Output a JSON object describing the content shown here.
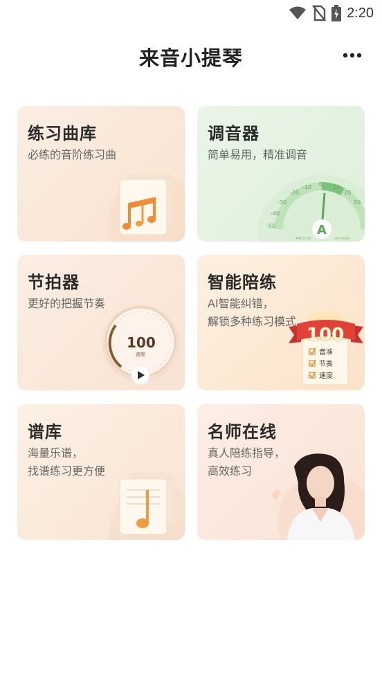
{
  "status_bar": {
    "time": "2:20",
    "icons": [
      "wifi-icon",
      "no-sim-icon",
      "battery-charging-icon"
    ]
  },
  "header": {
    "title": "来音小提琴",
    "more_icon": "more-icon"
  },
  "cards": [
    {
      "title": "练习曲库",
      "subtitle_lines": [
        "必练的音阶练习曲"
      ],
      "icon": "music-sheet-icon"
    },
    {
      "title": "调音器",
      "subtitle_lines": [
        "简单易用，精准调音"
      ],
      "icon": "tuner-gauge-icon",
      "gauge": {
        "scale": [
          "-50",
          "-40",
          "-30",
          "-20",
          "-10",
          "0",
          "10",
          "20",
          "30"
        ],
        "note": "A",
        "left_reading": "440.0 Hz",
        "right_reading": "+0 cents"
      }
    },
    {
      "title": "节拍器",
      "subtitle_lines": [
        "更好的把握节奏"
      ],
      "icon": "metronome-dial-icon",
      "dial": {
        "value": "100",
        "label": "速度"
      }
    },
    {
      "title": "智能陪练",
      "subtitle_lines": [
        "AI智能纠错，",
        "解锁多种练习模式"
      ],
      "icon": "score-badge-icon",
      "badge": {
        "score": "100",
        "checks": [
          "音准",
          "节奏",
          "速度"
        ]
      }
    },
    {
      "title": "谱库",
      "subtitle_lines": [
        "海量乐谱，",
        "找谱练习更方便"
      ],
      "icon": "sheet-note-icon"
    },
    {
      "title": "名师在线",
      "subtitle_lines": [
        "真人陪练指导，",
        "高效练习"
      ],
      "icon": "teacher-portrait"
    }
  ],
  "colors": {
    "accent_orange": "#f29a3e",
    "tuner_green": "#7cc27a",
    "badge_red": "#e2413a"
  }
}
